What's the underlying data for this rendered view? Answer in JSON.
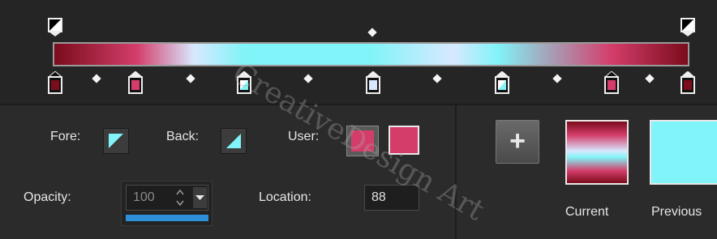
{
  "gradient": {
    "colors": {
      "dark_red": "#7a0c1c",
      "pink": "#d43d6a",
      "light_blue": "#d8e8ff",
      "cyan": "#80f4f8",
      "handle_white": "#ffffff"
    },
    "opacity_stops": [
      "opacity-stop-left",
      "opacity-stop-right"
    ],
    "color_stops": [
      "dark-red-stop",
      "pink-stop",
      "cyan-stop",
      "light-blue-stop",
      "cyan-stop",
      "pink-stop",
      "dark-red-stop"
    ]
  },
  "controls": {
    "fore_label": "Fore:",
    "back_label": "Back:",
    "user_label": "User:",
    "opacity_label": "Opacity:",
    "opacity_value": "100",
    "location_label": "Location:",
    "location_value": "88"
  },
  "preview": {
    "add_symbol": "+",
    "current_label": "Current",
    "previous_label": "Previous"
  },
  "watermark": {
    "text": "CreativeDesign Art"
  }
}
